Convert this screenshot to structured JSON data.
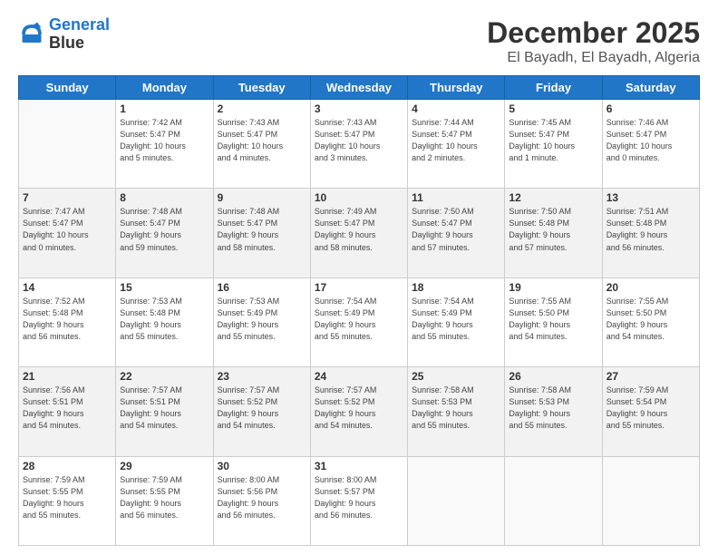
{
  "logo": {
    "line1": "General",
    "line2": "Blue"
  },
  "header": {
    "month": "December 2025",
    "location": "El Bayadh, El Bayadh, Algeria"
  },
  "weekdays": [
    "Sunday",
    "Monday",
    "Tuesday",
    "Wednesday",
    "Thursday",
    "Friday",
    "Saturday"
  ],
  "weeks": [
    [
      {
        "day": "",
        "info": ""
      },
      {
        "day": "1",
        "info": "Sunrise: 7:42 AM\nSunset: 5:47 PM\nDaylight: 10 hours\nand 5 minutes."
      },
      {
        "day": "2",
        "info": "Sunrise: 7:43 AM\nSunset: 5:47 PM\nDaylight: 10 hours\nand 4 minutes."
      },
      {
        "day": "3",
        "info": "Sunrise: 7:43 AM\nSunset: 5:47 PM\nDaylight: 10 hours\nand 3 minutes."
      },
      {
        "day": "4",
        "info": "Sunrise: 7:44 AM\nSunset: 5:47 PM\nDaylight: 10 hours\nand 2 minutes."
      },
      {
        "day": "5",
        "info": "Sunrise: 7:45 AM\nSunset: 5:47 PM\nDaylight: 10 hours\nand 1 minute."
      },
      {
        "day": "6",
        "info": "Sunrise: 7:46 AM\nSunset: 5:47 PM\nDaylight: 10 hours\nand 0 minutes."
      }
    ],
    [
      {
        "day": "7",
        "info": "Sunrise: 7:47 AM\nSunset: 5:47 PM\nDaylight: 10 hours\nand 0 minutes."
      },
      {
        "day": "8",
        "info": "Sunrise: 7:48 AM\nSunset: 5:47 PM\nDaylight: 9 hours\nand 59 minutes."
      },
      {
        "day": "9",
        "info": "Sunrise: 7:48 AM\nSunset: 5:47 PM\nDaylight: 9 hours\nand 58 minutes."
      },
      {
        "day": "10",
        "info": "Sunrise: 7:49 AM\nSunset: 5:47 PM\nDaylight: 9 hours\nand 58 minutes."
      },
      {
        "day": "11",
        "info": "Sunrise: 7:50 AM\nSunset: 5:47 PM\nDaylight: 9 hours\nand 57 minutes."
      },
      {
        "day": "12",
        "info": "Sunrise: 7:50 AM\nSunset: 5:48 PM\nDaylight: 9 hours\nand 57 minutes."
      },
      {
        "day": "13",
        "info": "Sunrise: 7:51 AM\nSunset: 5:48 PM\nDaylight: 9 hours\nand 56 minutes."
      }
    ],
    [
      {
        "day": "14",
        "info": "Sunrise: 7:52 AM\nSunset: 5:48 PM\nDaylight: 9 hours\nand 56 minutes."
      },
      {
        "day": "15",
        "info": "Sunrise: 7:53 AM\nSunset: 5:48 PM\nDaylight: 9 hours\nand 55 minutes."
      },
      {
        "day": "16",
        "info": "Sunrise: 7:53 AM\nSunset: 5:49 PM\nDaylight: 9 hours\nand 55 minutes."
      },
      {
        "day": "17",
        "info": "Sunrise: 7:54 AM\nSunset: 5:49 PM\nDaylight: 9 hours\nand 55 minutes."
      },
      {
        "day": "18",
        "info": "Sunrise: 7:54 AM\nSunset: 5:49 PM\nDaylight: 9 hours\nand 55 minutes."
      },
      {
        "day": "19",
        "info": "Sunrise: 7:55 AM\nSunset: 5:50 PM\nDaylight: 9 hours\nand 54 minutes."
      },
      {
        "day": "20",
        "info": "Sunrise: 7:55 AM\nSunset: 5:50 PM\nDaylight: 9 hours\nand 54 minutes."
      }
    ],
    [
      {
        "day": "21",
        "info": "Sunrise: 7:56 AM\nSunset: 5:51 PM\nDaylight: 9 hours\nand 54 minutes."
      },
      {
        "day": "22",
        "info": "Sunrise: 7:57 AM\nSunset: 5:51 PM\nDaylight: 9 hours\nand 54 minutes."
      },
      {
        "day": "23",
        "info": "Sunrise: 7:57 AM\nSunset: 5:52 PM\nDaylight: 9 hours\nand 54 minutes."
      },
      {
        "day": "24",
        "info": "Sunrise: 7:57 AM\nSunset: 5:52 PM\nDaylight: 9 hours\nand 54 minutes."
      },
      {
        "day": "25",
        "info": "Sunrise: 7:58 AM\nSunset: 5:53 PM\nDaylight: 9 hours\nand 55 minutes."
      },
      {
        "day": "26",
        "info": "Sunrise: 7:58 AM\nSunset: 5:53 PM\nDaylight: 9 hours\nand 55 minutes."
      },
      {
        "day": "27",
        "info": "Sunrise: 7:59 AM\nSunset: 5:54 PM\nDaylight: 9 hours\nand 55 minutes."
      }
    ],
    [
      {
        "day": "28",
        "info": "Sunrise: 7:59 AM\nSunset: 5:55 PM\nDaylight: 9 hours\nand 55 minutes."
      },
      {
        "day": "29",
        "info": "Sunrise: 7:59 AM\nSunset: 5:55 PM\nDaylight: 9 hours\nand 56 minutes."
      },
      {
        "day": "30",
        "info": "Sunrise: 8:00 AM\nSunset: 5:56 PM\nDaylight: 9 hours\nand 56 minutes."
      },
      {
        "day": "31",
        "info": "Sunrise: 8:00 AM\nSunset: 5:57 PM\nDaylight: 9 hours\nand 56 minutes."
      },
      {
        "day": "",
        "info": ""
      },
      {
        "day": "",
        "info": ""
      },
      {
        "day": "",
        "info": ""
      }
    ]
  ]
}
